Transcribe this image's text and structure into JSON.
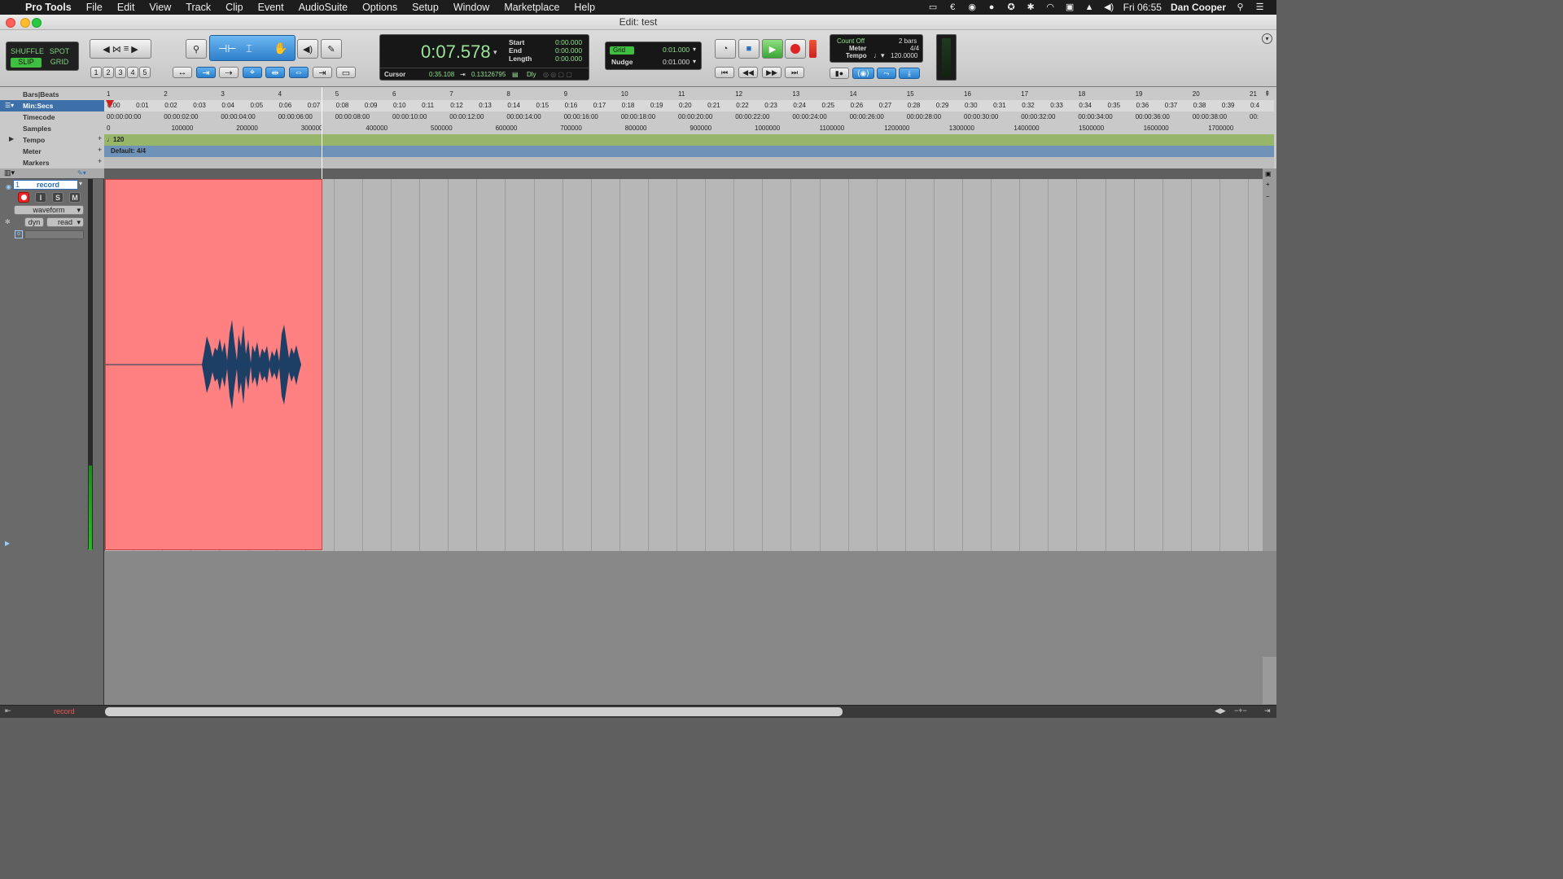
{
  "menubar": {
    "app_name": "Pro Tools",
    "items": [
      "File",
      "Edit",
      "View",
      "Track",
      "Clip",
      "Event",
      "AudioSuite",
      "Options",
      "Setup",
      "Window",
      "Marketplace",
      "Help"
    ],
    "clock": "Fri 06:55",
    "user": "Dan Cooper"
  },
  "window": {
    "title": "Edit: test"
  },
  "modes": {
    "shuffle": "SHUFFLE",
    "spot": "SPOT",
    "slip": "SLIP",
    "grid": "GRID"
  },
  "zoom_presets": [
    "1",
    "2",
    "3",
    "4",
    "5"
  ],
  "counter": {
    "main": "0:07.578",
    "start_label": "Start",
    "start": "0:00.000",
    "end_label": "End",
    "end": "0:00.000",
    "length_label": "Length",
    "length": "0:00.000",
    "cursor_label": "Cursor",
    "cursor": "0:35.108",
    "cursor_sample": "0.13126795",
    "dly_label": "Dly"
  },
  "grid": {
    "grid_label": "Grid",
    "grid_value": "0:01.000",
    "nudge_label": "Nudge",
    "nudge_value": "0:01.000"
  },
  "midi": {
    "count_off": "Count Off",
    "bars": "2 bars",
    "meter_label": "Meter",
    "meter": "4/4",
    "tempo_label": "Tempo",
    "tempo": "120.0000"
  },
  "rulers": {
    "labels": [
      "Bars|Beats",
      "Min:Secs",
      "Timecode",
      "Samples",
      "Tempo",
      "Meter",
      "Markers"
    ],
    "bars": [
      "1",
      "2",
      "3",
      "4",
      "5",
      "6",
      "7",
      "8",
      "9",
      "10",
      "11",
      "12",
      "13",
      "14",
      "15",
      "16",
      "17",
      "18",
      "19",
      "20",
      "21"
    ],
    "minsecs": [
      "0:00",
      "0:01",
      "0:02",
      "0:03",
      "0:04",
      "0:05",
      "0:06",
      "0:07",
      "0:08",
      "0:09",
      "0:10",
      "0:11",
      "0:12",
      "0:13",
      "0:14",
      "0:15",
      "0:16",
      "0:17",
      "0:18",
      "0:19",
      "0:20",
      "0:21",
      "0:22",
      "0:23",
      "0:24",
      "0:25",
      "0:26",
      "0:27",
      "0:28",
      "0:29",
      "0:30",
      "0:31",
      "0:32",
      "0:33",
      "0:34",
      "0:35",
      "0:36",
      "0:37",
      "0:38",
      "0:39",
      "0:4"
    ],
    "timecode": [
      "00:00:00:00",
      "00:00:02:00",
      "00:00:04:00",
      "00:00:06:00",
      "00:00:08:00",
      "00:00:10:00",
      "00:00:12:00",
      "00:00:14:00",
      "00:00:16:00",
      "00:00:18:00",
      "00:00:20:00",
      "00:00:22:00",
      "00:00:24:00",
      "00:00:26:00",
      "00:00:28:00",
      "00:00:30:00",
      "00:00:32:00",
      "00:00:34:00",
      "00:00:36:00",
      "00:00:38:00",
      "00:"
    ],
    "samples": [
      "0",
      "100000",
      "200000",
      "300000",
      "400000",
      "500000",
      "600000",
      "700000",
      "800000",
      "900000",
      "1000000",
      "1100000",
      "1200000",
      "1300000",
      "1400000",
      "1500000",
      "1600000",
      "1700000"
    ],
    "tempo_marker": "120",
    "meter_marker": "Default: 4/4"
  },
  "track": {
    "number": "1",
    "name": "record",
    "rec": "",
    "input": "I",
    "solo": "S",
    "mute": "M",
    "view": "waveform",
    "dyn": "dyn",
    "automation": "read"
  },
  "bottom": {
    "track_name": "record"
  }
}
